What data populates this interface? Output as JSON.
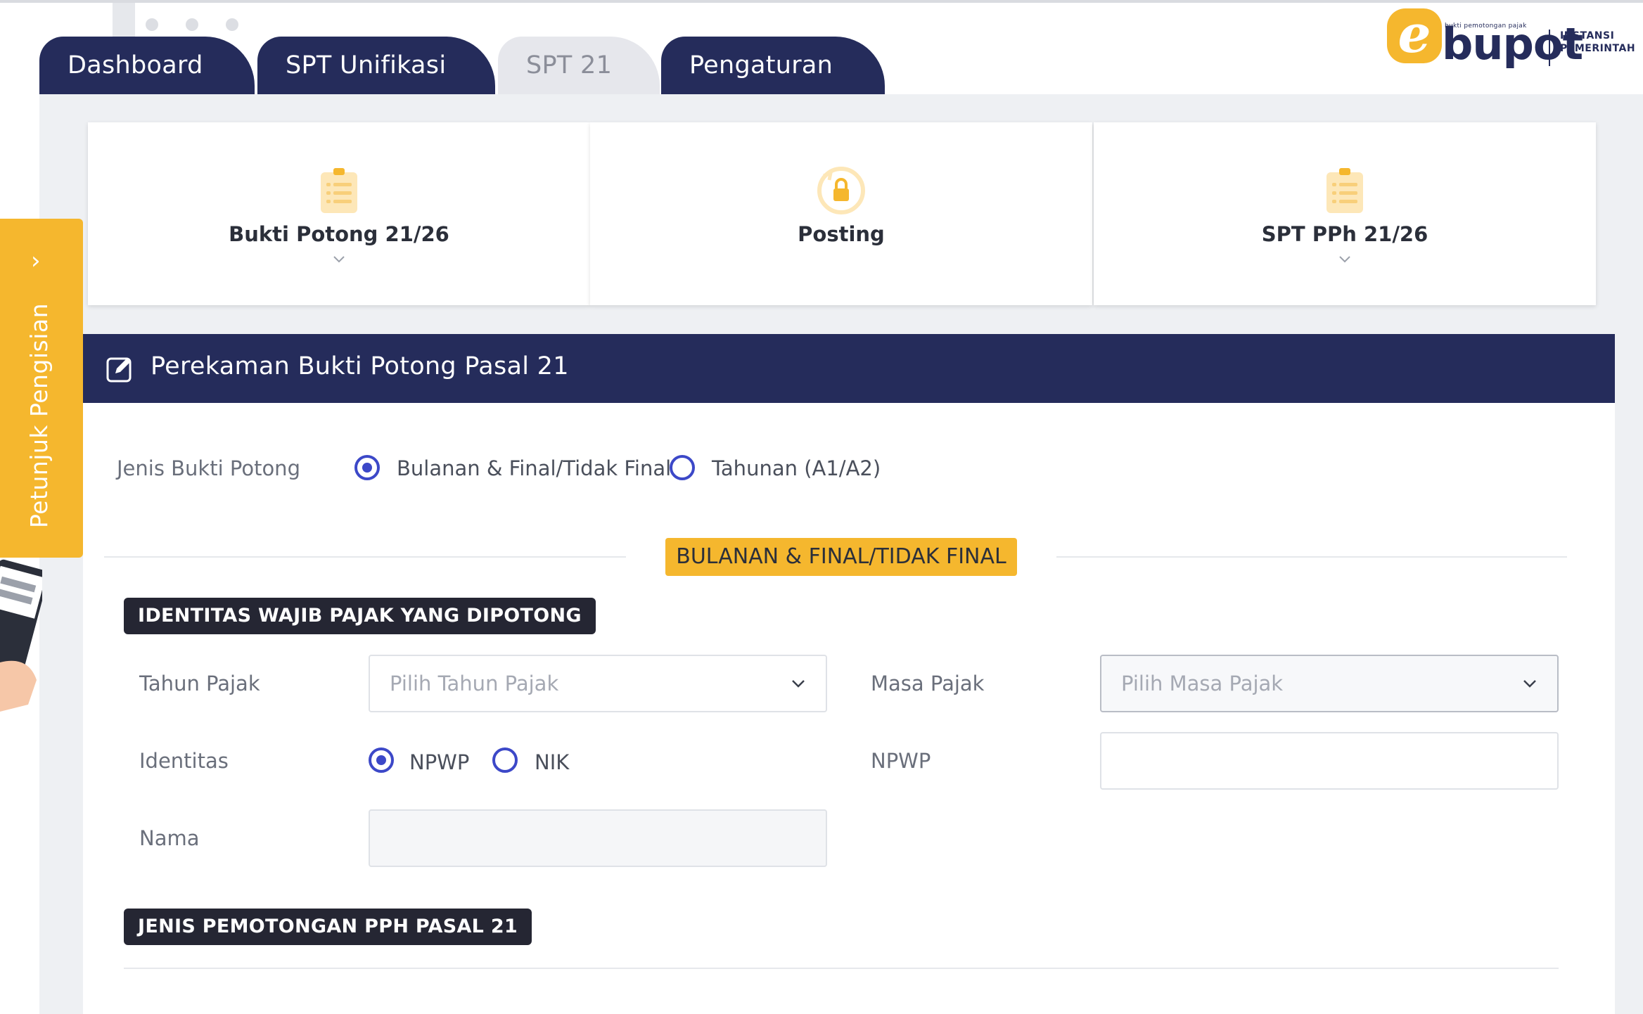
{
  "tabs": [
    {
      "label": "Dashboard",
      "active": true
    },
    {
      "label": "SPT Unifikasi",
      "active": true
    },
    {
      "label": "SPT 21",
      "active": false
    },
    {
      "label": "Pengaturan",
      "active": true
    }
  ],
  "logo": {
    "letter": "e",
    "word": "bupot",
    "small_text": "bukti pemotongan pajak",
    "right_line1": "INSTANSI",
    "right_line2": "PEMERINTAH"
  },
  "cards": [
    {
      "label": "Bukti Potong 21/26",
      "icon": "clipboard-icon",
      "has_dropdown": true
    },
    {
      "label": "Posting",
      "icon": "lock-refresh-icon",
      "has_dropdown": false
    },
    {
      "label": "SPT PPh 21/26",
      "icon": "clipboard-icon",
      "has_dropdown": true
    }
  ],
  "guide": {
    "label": "Petunjuk Pengisian",
    "arrow": "›"
  },
  "form": {
    "title": "Perekaman Bukti Potong Pasal 21",
    "jenis_label": "Jenis Bukti Potong",
    "jenis_options": [
      {
        "label": "Bulanan & Final/Tidak Final",
        "checked": true
      },
      {
        "label": "Tahunan (A1/A2)",
        "checked": false
      }
    ],
    "section_badge": "BULANAN & FINAL/TIDAK FINAL",
    "identitas_header": "IDENTITAS WAJIB PAJAK YANG DIPOTONG",
    "tahun_label": "Tahun Pajak",
    "tahun_placeholder": "Pilih Tahun Pajak",
    "masa_label": "Masa Pajak",
    "masa_placeholder": "Pilih Masa Pajak",
    "identitas_label": "Identitas",
    "identitas_options": [
      {
        "label": "NPWP",
        "checked": true
      },
      {
        "label": "NIK",
        "checked": false
      }
    ],
    "npwp_label": "NPWP",
    "npwp_value": "",
    "nama_label": "Nama",
    "nama_value": "",
    "jenis_pemotongan_header": "JENIS PEMOTONGAN PPH PASAL 21"
  },
  "colors": {
    "navy": "#252c5b",
    "accent_yellow": "#f5b72e",
    "radio_blue": "#3c48c8"
  }
}
